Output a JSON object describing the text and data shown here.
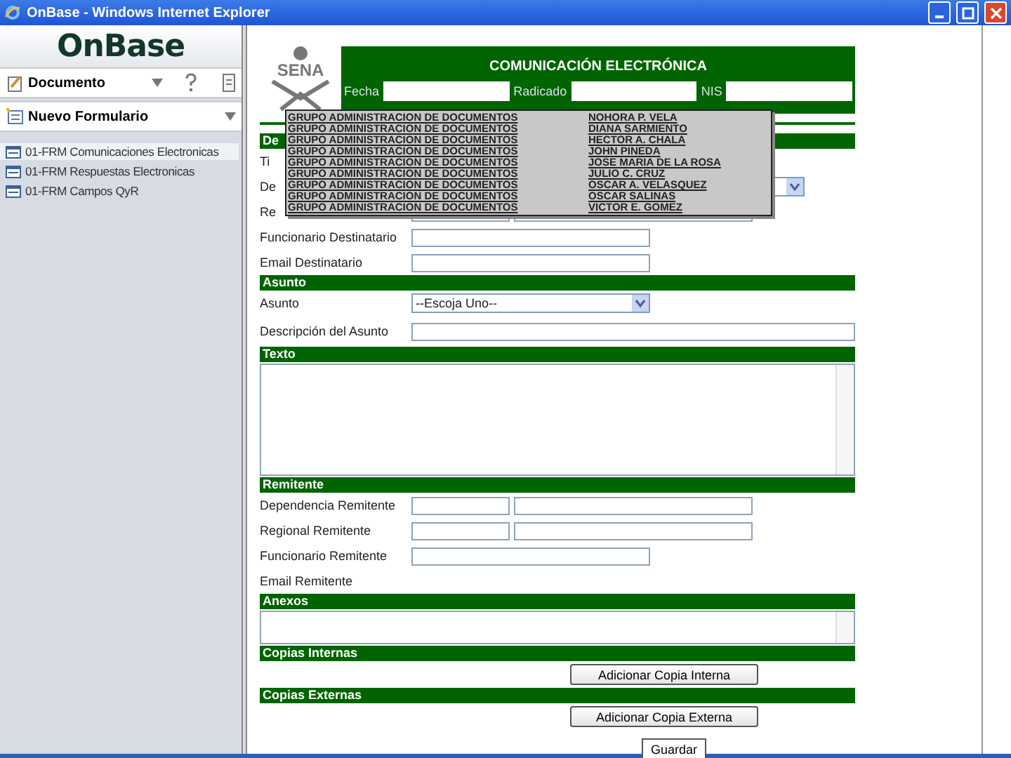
{
  "window": {
    "title": "OnBase - Windows Internet Explorer"
  },
  "sidebar": {
    "logo": "OnBase",
    "document_menu": "Documento",
    "new_form": "Nuevo Formulario",
    "items": [
      {
        "label": "01-FRM Comunicaciones Electronicas",
        "selected": true
      },
      {
        "label": "01-FRM Respuestas Electronicas",
        "selected": false
      },
      {
        "label": "01-FRM Campos QyR",
        "selected": false
      }
    ]
  },
  "form": {
    "logo": "SENA",
    "title": "COMUNICACIÓN ELECTRÓNICA",
    "header_fields": [
      {
        "label": "Fecha"
      },
      {
        "label": "Radicado"
      },
      {
        "label": "NIS"
      }
    ],
    "sections": [
      {
        "title": "De",
        "rows": [
          {
            "kind": "blank",
            "label": "Ti"
          },
          {
            "kind": "select",
            "label": "De"
          },
          {
            "kind": "double",
            "label": "Re"
          },
          {
            "kind": "text",
            "label": "Funcionario Destinatario"
          },
          {
            "kind": "text",
            "label": "Email Destinatario"
          }
        ]
      },
      {
        "title": "Asunto",
        "rows": [
          {
            "kind": "select",
            "label": "Asunto",
            "value": "--Escoja Uno--"
          },
          {
            "kind": "wide",
            "label": "Descripción del Asunto"
          }
        ]
      },
      {
        "title": "Texto",
        "rows": [
          {
            "kind": "textarea"
          }
        ]
      },
      {
        "title": "Remitente",
        "rows": [
          {
            "kind": "double",
            "label": "Dependencia Remitente"
          },
          {
            "kind": "double",
            "label": "Regional Remitente"
          },
          {
            "kind": "text",
            "label": "Funcionario Remitente"
          },
          {
            "kind": "blank",
            "label": "Email Remitente"
          }
        ]
      },
      {
        "title": "Anexos",
        "rows": [
          {
            "kind": "smallarea"
          }
        ]
      },
      {
        "title": "Copias Internas",
        "rows": [
          {
            "kind": "button",
            "label": "Adicionar Copia Interna"
          }
        ]
      },
      {
        "title": "Copias Externas",
        "rows": [
          {
            "kind": "button",
            "label": "Adicionar Copia Externa"
          }
        ]
      }
    ],
    "save_button": "Guardar"
  },
  "popup": {
    "rows": [
      {
        "group": "GRUPO ADMINISTRACION DE DOCUMENTOS",
        "name": "NOHORA P. VELA"
      },
      {
        "group": "GRUPO ADMINISTRACION DE DOCUMENTOS",
        "name": "DIANA SARMIENTO"
      },
      {
        "group": "GRUPO ADMINISTRACION DE DOCUMENTOS",
        "name": "HECTOR A. CHALA"
      },
      {
        "group": "GRUPO ADMINISTRACION DE DOCUMENTOS",
        "name": "JOHN PINEDA"
      },
      {
        "group": "GRUPO ADMINISTRACION DE DOCUMENTOS",
        "name": "JOSE MARIA DE LA ROSA"
      },
      {
        "group": "GRUPO ADMINISTRACION DE DOCUMENTOS",
        "name": "JULIO C. CRUZ"
      },
      {
        "group": "GRUPO ADMINISTRACION DE DOCUMENTOS",
        "name": "OSCAR A. VELASQUEZ"
      },
      {
        "group": "GRUPO ADMINISTRACION DE DOCUMENTOS",
        "name": "OSCAR SALINAS"
      },
      {
        "group": "GRUPO ADMINISTRACION DE DOCUMENTOS",
        "name": "VICTOR E. GOMEZ"
      }
    ]
  }
}
